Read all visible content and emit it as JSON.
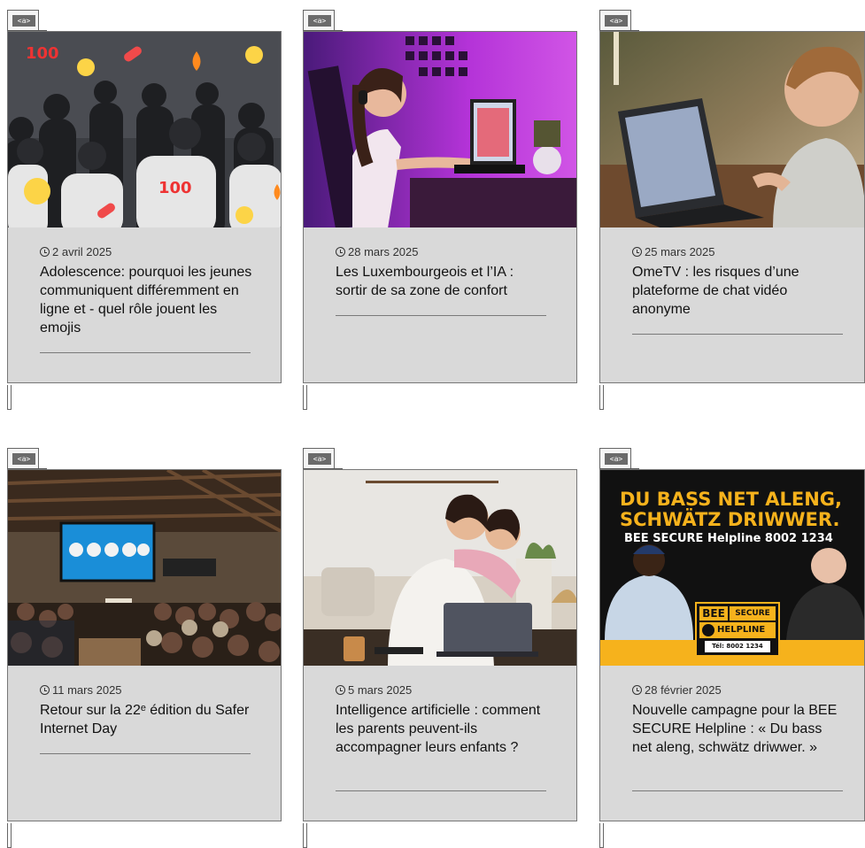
{
  "tag_label": "<a>",
  "cards": [
    {
      "date": "2 avril 2025",
      "title": "Adolescence: pourquoi les jeunes communiquent différemment en ligne et - quel rôle jouent les emojis"
    },
    {
      "date": "28 mars 2025",
      "title": "Les Luxembourgeois et l’IA : sortir de sa zone de confort"
    },
    {
      "date": "25 mars 2025",
      "title": "OmeTV : les risques d’une plateforme de chat vidéo anonyme"
    },
    {
      "date": "11 mars 2025",
      "title": "Retour sur la 22ᵉ édition du Safer Internet Day"
    },
    {
      "date": "5 mars 2025",
      "title": "Intelligence artificielle : comment les parents peuvent-ils accompagner leurs enfants ?"
    },
    {
      "date": "28 février 2025",
      "title": "Nouvelle campagne pour la BEE SECURE Helpline : « Du bass net aleng, schwätz driwwer. »"
    }
  ],
  "campaign": {
    "headline_1": "DU BASS NET ALENG,",
    "headline_2": "SCHWÄTZ DRIWWER.",
    "subline": "BEE SECURE Helpline 8002 1234",
    "badge_brand": "BEE",
    "badge_secure": "SECURE",
    "badge_helpline": "HELPLINE",
    "badge_phone": "Tél: 8002 1234"
  },
  "colors": {
    "card_body": "#d9d9d9",
    "campaign_bg": "#111111",
    "campaign_yellow": "#f6b21c",
    "campaign_accent": "#f6b21c"
  }
}
